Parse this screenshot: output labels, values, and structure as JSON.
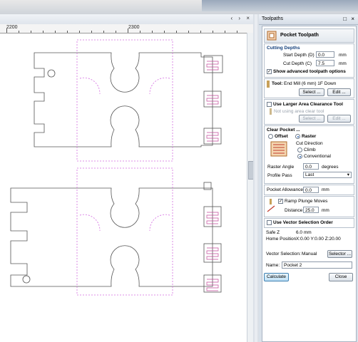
{
  "canvas": {
    "ruler_labels": [
      "2200",
      "2300"
    ],
    "controls": "‹ › ×"
  },
  "panel": {
    "title": "Toolpaths",
    "controls": "□ ×",
    "header": "Pocket Toolpath",
    "cutting_depths": {
      "heading": "Cutting Depths",
      "start_label": "Start Depth (D)",
      "start_value": "0.0",
      "start_unit": "mm",
      "cut_label": "Cut Depth (C)",
      "cut_value": "7.5",
      "cut_unit": "mm",
      "advanced_label": "Show advanced toolpath options"
    },
    "tool": {
      "label": "Tool:",
      "value": "End Mill (6 mm) 1F Down",
      "select": "Select ...",
      "edit": "Edit ..."
    },
    "area_clear": {
      "label": "Use Larger Area Clearance Tool",
      "status": "Not using area clear tool",
      "select": "Select ...",
      "edit": "Edit ..."
    },
    "clear_pocket": {
      "heading": "Clear Pocket ...",
      "offset": "Offset",
      "raster": "Raster",
      "cut_direction": "Cut Direction",
      "climb": "Climb",
      "conventional": "Conventional",
      "raster_angle_label": "Raster Angle",
      "raster_angle_value": "0.0",
      "raster_angle_unit": "degrees",
      "profile_pass_label": "Profile Pass",
      "profile_pass_value": "Last"
    },
    "allowance": {
      "label": "Pocket Allowance",
      "value": "0.0",
      "unit": "mm"
    },
    "ramp": {
      "label": "Ramp Plunge Moves",
      "distance_label": "Distance",
      "distance_value": "25.0",
      "distance_unit": "mm"
    },
    "vector_order": {
      "label": "Use Vector Selection Order"
    },
    "info": {
      "safe_z_label": "Safe Z",
      "safe_z_value": "6.0 mm",
      "home_label": "Home Position",
      "home_value": "X:0.00 Y:0.00 Z:20.00"
    },
    "vector_selection": {
      "label": "Vector Selection:",
      "value": "Manual",
      "button": "Selector ..."
    },
    "name": {
      "label": "Name:",
      "value": "Pocket 2"
    },
    "calculate": "Calculate",
    "close": "Close"
  },
  "colors": {
    "accent": "#2a63b5",
    "toolpath_dashed": "#d36be0"
  }
}
